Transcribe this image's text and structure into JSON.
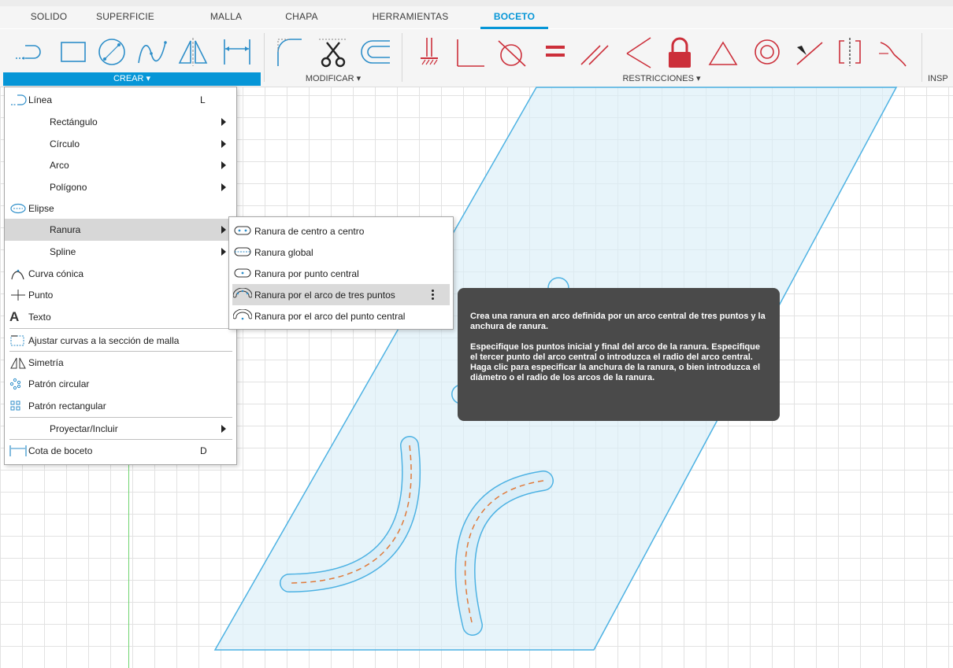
{
  "tabs": [
    {
      "label": "SOLIDO",
      "active": false
    },
    {
      "label": "SUPERFICIE",
      "active": false
    },
    {
      "label": "MALLA",
      "active": false
    },
    {
      "label": "CHAPA",
      "active": false
    },
    {
      "label": "HERRAMIENTAS",
      "active": false
    },
    {
      "label": "BOCETO",
      "active": true
    }
  ],
  "ribbon": {
    "groups": [
      {
        "label": "CREAR ▾",
        "active": true
      },
      {
        "label": "MODIFICAR ▾",
        "active": false
      },
      {
        "label": "RESTRICCIONES ▾",
        "active": false
      },
      {
        "label": "INSP",
        "active": false
      }
    ],
    "create_icons": [
      "slot-line-icon",
      "rectangle-icon",
      "circle-icon",
      "spline-icon",
      "mirror-icon",
      "dimension-icon"
    ],
    "modify_icons": [
      "fillet-icon",
      "trim-scissors-icon",
      "offset-icon"
    ],
    "constraint_icons": [
      "fix-ground-icon",
      "perpendicular-icon",
      "tangent-icon",
      "equal-icon",
      "parallel-icon",
      "coincident-icon",
      "lock-icon",
      "triangle-icon",
      "concentric-icon",
      "midpoint-icon",
      "symmetry-icon",
      "curvature-icon"
    ],
    "accent_color": "#0696d7",
    "constraint_color": "#cc2f3a"
  },
  "create_menu": {
    "items": [
      {
        "label": "Línea",
        "shortcut": "L",
        "icon": "line-icon"
      },
      {
        "label": "Rectángulo",
        "submenu": true
      },
      {
        "label": "Círculo",
        "submenu": true
      },
      {
        "label": "Arco",
        "submenu": true
      },
      {
        "label": "Polígono",
        "submenu": true
      },
      {
        "label": "Elipse",
        "icon": "ellipse-icon"
      },
      {
        "label": "Ranura",
        "submenu": true,
        "highlighted": true
      },
      {
        "label": "Spline",
        "submenu": true
      },
      {
        "label": "Curva cónica",
        "icon": "conic-curve-icon"
      },
      {
        "label": "Punto",
        "icon": "point-icon"
      },
      {
        "label": "Texto",
        "icon": "text-icon"
      },
      {
        "label": "Ajustar curvas a la sección de malla",
        "icon": "fit-curves-icon"
      },
      {
        "label": "Simetría",
        "icon": "mirror-icon"
      },
      {
        "label": "Patrón circular",
        "icon": "circular-pattern-icon"
      },
      {
        "label": "Patrón rectangular",
        "icon": "rectangular-pattern-icon"
      },
      {
        "label": "Proyectar/Incluir",
        "submenu": true
      },
      {
        "label": "Cota de boceto",
        "shortcut": "D",
        "icon": "sketch-dimension-icon"
      }
    ]
  },
  "slot_submenu": {
    "items": [
      {
        "label": "Ranura de centro a centro",
        "icon": "center-slot-icon"
      },
      {
        "label": "Ranura global",
        "icon": "overall-slot-icon"
      },
      {
        "label": "Ranura por punto central",
        "icon": "center-point-slot-icon"
      },
      {
        "label": "Ranura por el arco de tres puntos",
        "icon": "three-point-arc-slot-icon",
        "highlighted": true
      },
      {
        "label": "Ranura por el arco del punto central",
        "icon": "center-point-arc-slot-icon"
      }
    ]
  },
  "tooltip": {
    "paragraph1": "Crea una ranura en arco definida por un arco central de tres puntos y la anchura de ranura.",
    "paragraph2": "Especifique los puntos inicial y final del arco de la ranura. Especifique el tercer punto del arco central o introduzca el radio del arco central. Haga clic para especificar la anchura de la ranura, o bien introduzca el diámetro o el radio de los arcos de la ranura."
  }
}
